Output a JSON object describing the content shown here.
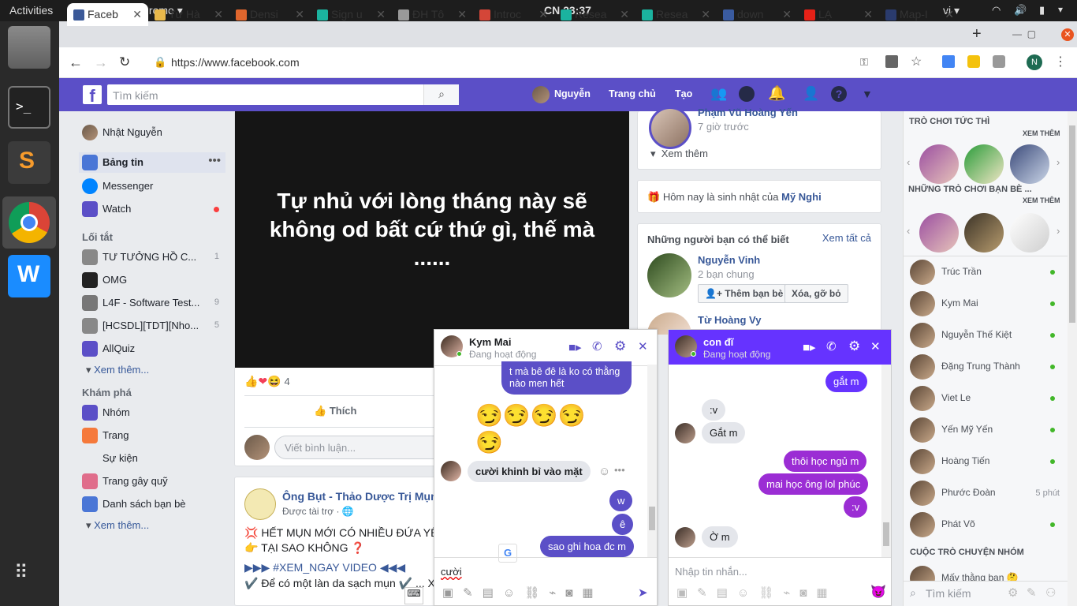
{
  "gnome": {
    "activities": "Activities",
    "app": "Google Chrome ▾",
    "clock": "CN 23:37",
    "lang": "vi ▾"
  },
  "tabs": [
    {
      "label": "Faceb",
      "color": "#3b5998"
    },
    {
      "label": "Từ Hà",
      "color": "#e8b84a"
    },
    {
      "label": "Densi",
      "color": "#e0662d"
    },
    {
      "label": "Sign u",
      "color": "#1bb39f"
    },
    {
      "label": "ĐH Tô",
      "color": "#999"
    },
    {
      "label": "Introc",
      "color": "#d44638"
    },
    {
      "label": "Resea",
      "color": "#1bb39f"
    },
    {
      "label": "Resea",
      "color": "#1bb39f"
    },
    {
      "label": "down",
      "color": "#3a5ba0"
    },
    {
      "label": "LẠ",
      "color": "#e62117"
    },
    {
      "label": "Map-I",
      "color": "#2a3b6d"
    }
  ],
  "url": "https://www.facebook.com",
  "profile_initial": "N",
  "fb": {
    "search_placeholder": "Tìm kiếm",
    "user": "Nguyễn",
    "home": "Trang chủ",
    "create": "Tạo"
  },
  "left": {
    "user": "Nhật Nguyễn",
    "items": [
      {
        "label": "Bảng tin"
      },
      {
        "label": "Messenger"
      },
      {
        "label": "Watch"
      }
    ],
    "shortcuts_title": "Lối tắt",
    "shortcuts": [
      {
        "label": "TƯ TƯỞNG HỒ C...",
        "count": "1"
      },
      {
        "label": "OMG",
        "count": ""
      },
      {
        "label": "L4F - Software Test...",
        "count": "9"
      },
      {
        "label": "[HCSDL][TDT][Nho...",
        "count": "5"
      },
      {
        "label": "AllQuiz",
        "count": ""
      }
    ],
    "see_more": "Xem thêm...",
    "explore_title": "Khám phá",
    "explore": [
      {
        "label": "Nhóm"
      },
      {
        "label": "Trang"
      },
      {
        "label": "Sự kiện"
      },
      {
        "label": "Trang gây quỹ"
      },
      {
        "label": "Danh sách bạn bè"
      }
    ],
    "see_more2": "Xem thêm..."
  },
  "post": {
    "text": "Tự nhủ với lòng tháng này sẽ không od bất cứ thứ gì, thế mà ......",
    "reactions": "4",
    "like": "Thích",
    "comment_placeholder": "Viết bình luận..."
  },
  "post2": {
    "page": "Ông Bụt - Thảo Dược Trị Mụn",
    "sponsored": "Được tài trợ · ",
    "line1": "💢 HẾT MỤN MỚI CÓ NHIỀU ĐỨA YÊ",
    "line2": "👉 TẠI SAO KHÔNG ❓",
    "line3": "▶▶▶ #XEM_NGAY VIDEO ◀◀◀",
    "line4": "✔️ Để có một làn da sạch mụn ✔️ ... Xe"
  },
  "mid": {
    "partial_name": "Phạm Vũ Hoàng Yến",
    "time": "7 giờ trước",
    "see_more": "Xem thêm",
    "birthday_pre": "Hôm nay là sinh nhật của ",
    "birthday_name": "Mỹ Nghi",
    "pymk_title": "Những người bạn có thể biết",
    "see_all": "Xem tất cả",
    "p1_name": "Nguyễn Vinh",
    "p1_mutual": "2 bạn chung",
    "add_friend": "Thêm bạn bè",
    "remove": "Xóa, gỡ bỏ",
    "p2_name": "Từ Hoàng Vy"
  },
  "chat1": {
    "name": "Kym Mai",
    "status": "Đang hoạt động",
    "m1": "t mà bê đê là ko có thằng nào men hết",
    "emoji": "😏😏😏😏😏",
    "m2": "cười khinh bỉ vào mặt",
    "m3": "w",
    "m4": "ê",
    "m5": "sao ghi hoa đc m",
    "input": "cười"
  },
  "chat2": {
    "name": "con đĩ",
    "status": "Đang hoạt động",
    "m1": "gắt m",
    "m2": ":v",
    "m3": "Gắt m",
    "m4": "thôi học ngủ m",
    "m5": "mai học ông lol phúc",
    "m6": ":v",
    "m7": "Ờ m",
    "input_placeholder": "Nhập tin nhắn..."
  },
  "right": {
    "instant_games": "TRÒ CHƠI TỨC THÌ",
    "see_more": "XEM THÊM",
    "friends_games": "NHỮNG TRÒ CHƠI BẠN BÈ ...",
    "see_more2": "XEM THÊM",
    "contacts": [
      {
        "name": "Trúc Trần",
        "status": ""
      },
      {
        "name": "Kym Mai",
        "status": ""
      },
      {
        "name": "Nguyễn Thế Kiệt",
        "status": ""
      },
      {
        "name": "Đặng Trung Thành",
        "status": ""
      },
      {
        "name": "Viet Le",
        "status": ""
      },
      {
        "name": "Yến Mỹ Yến",
        "status": ""
      },
      {
        "name": "Hoàng Tiến",
        "status": ""
      },
      {
        "name": "Phước Đoàn",
        "status": "5 phút"
      },
      {
        "name": "Phát Võ",
        "status": ""
      }
    ],
    "group_title": "CUỘC TRÒ CHUYỆN NHÓM",
    "group1": "Mấy thằng bạn 🤔",
    "search_placeholder": "Tìm kiếm"
  },
  "colors": {
    "fb_purple": "#5b4fc7",
    "chat_purple": "#9b2dd4",
    "online": "#42b72a"
  }
}
